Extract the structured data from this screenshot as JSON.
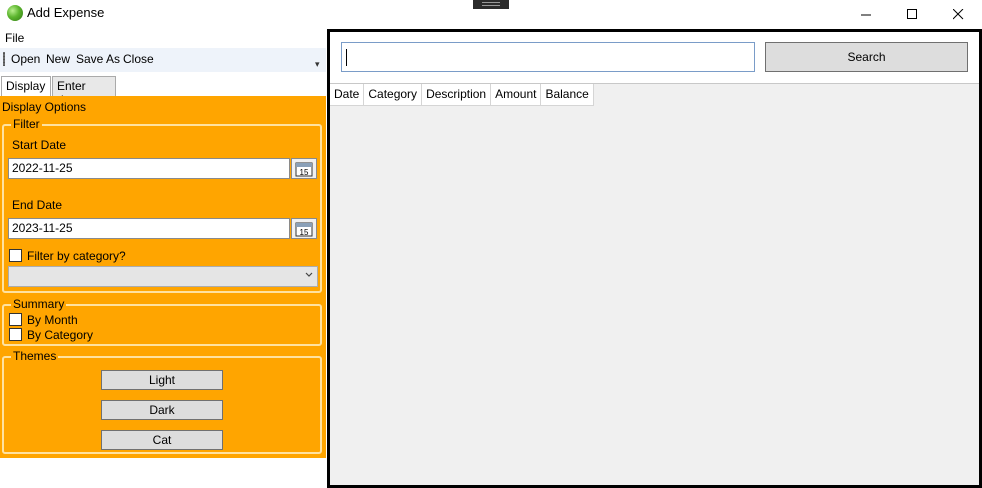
{
  "window": {
    "title": "Add Expense",
    "icons": {
      "app": "green-orb-icon",
      "minimize": "minimize-icon",
      "maximize": "maximize-icon",
      "close": "close-icon"
    }
  },
  "menu": {
    "file": "File"
  },
  "toolbar": {
    "open": "Open",
    "new": "New",
    "save_as": "Save As",
    "close": "Close"
  },
  "tabs": [
    {
      "label": "Display",
      "selected": true
    },
    {
      "label": "Enter data",
      "selected": false
    }
  ],
  "display": {
    "heading": "Display Options",
    "filter": {
      "title": "Filter",
      "start_label": "Start Date",
      "start_value": "2022-11-25",
      "end_label": "End Date",
      "end_value": "2023-11-25",
      "calendar_day": "15",
      "category_label": "Filter by category?",
      "category_checked": false,
      "category_selected": ""
    },
    "summary": {
      "title": "Summary",
      "by_month": "By Month",
      "by_category": "By Category"
    },
    "themes": {
      "title": "Themes",
      "light": "Light",
      "dark": "Dark",
      "cat": "Cat"
    }
  },
  "search": {
    "value": "",
    "button": "Search"
  },
  "grid": {
    "columns": [
      "Date",
      "Category",
      "Description",
      "Amount",
      "Balance"
    ],
    "rows": []
  },
  "colors": {
    "panel": "#ffa500",
    "group_border": "#ffe2a0",
    "pane_border": "#000000",
    "grid_background": "#f0f0f0"
  }
}
